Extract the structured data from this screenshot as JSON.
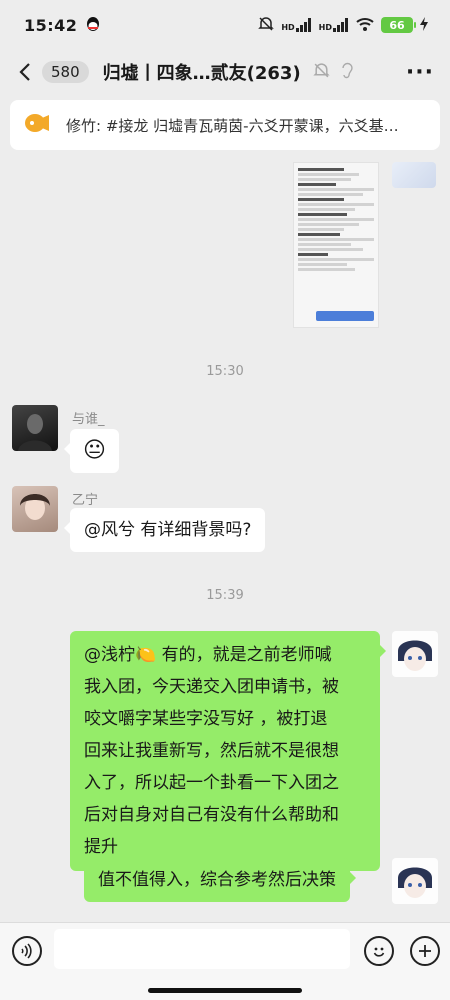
{
  "status_bar": {
    "time": "15:42",
    "battery": "66",
    "net_labels": [
      "HD",
      "HD"
    ]
  },
  "header": {
    "unread_count": "580",
    "title": "归墟丨四象…贰友(263)"
  },
  "announcement": {
    "text": "修竹: #接龙 归墟青瓦萌茵-六爻开蒙课，六爻基…"
  },
  "messages": [
    {
      "type": "timestamp",
      "text": "15:30"
    },
    {
      "type": "incoming",
      "sender": "与谁_",
      "content": "😐"
    },
    {
      "type": "incoming",
      "sender": "乙宁",
      "content": "@风兮  有详细背景吗?"
    },
    {
      "type": "timestamp",
      "text": "15:39"
    },
    {
      "type": "outgoing",
      "lines": [
        "@浅柠🍋  有的，就是之前老师喊",
        "我入团，今天递交入团申请书，被",
        "咬文嚼字某些字没写好 ，被打退",
        "回来让我重新写，然后就不是很想",
        "入了，所以起一个卦看一下入团之",
        "后对自身对自己有没有什么帮助和",
        "提升"
      ]
    },
    {
      "type": "outgoing",
      "content": "值不值得入，综合参考然后决策"
    }
  ],
  "colors": {
    "accent": "#95ec69",
    "background": "#ededed"
  },
  "icons": [
    "qq-icon",
    "mute-icon",
    "wifi-icon",
    "signal-icon",
    "back-icon",
    "bell-off-icon",
    "ear-icon",
    "more-icon",
    "megaphone-icon",
    "voice-icon",
    "emoji-icon",
    "plus-icon"
  ]
}
